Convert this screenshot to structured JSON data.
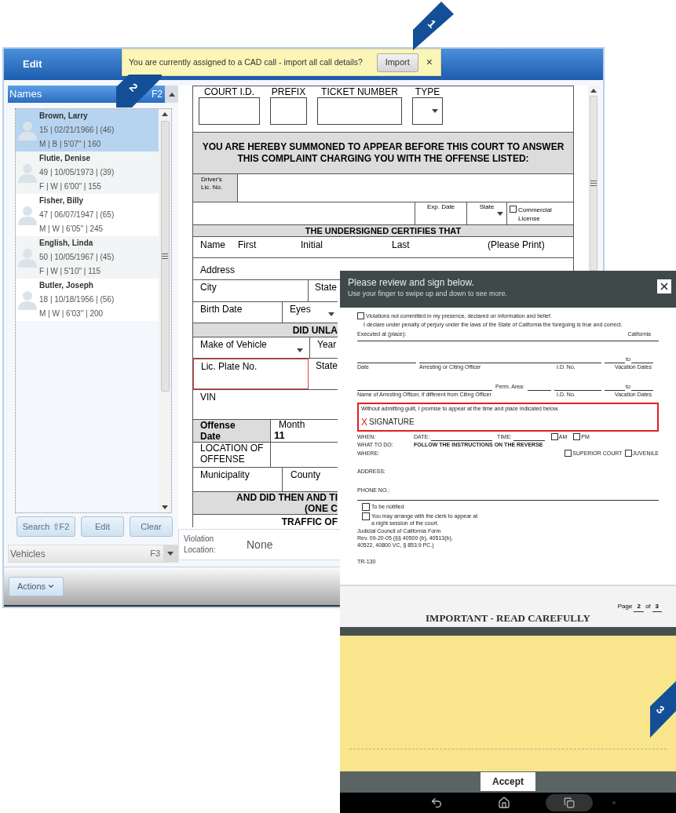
{
  "window": {
    "title": "Edit"
  },
  "notification": {
    "message": "You are currently assigned to a CAD call - import all call details?",
    "button": "Import",
    "close": "×"
  },
  "callouts": [
    {
      "number": "1"
    },
    {
      "number": "2"
    },
    {
      "number": "3"
    }
  ],
  "names_panel": {
    "title": "Names",
    "shortcut": "F2",
    "expanded": true,
    "items": [
      {
        "name": "Brown, Larry",
        "details": "15 | 02/21/1966 | (46)",
        "description": "M | B | 5'07\" | 160",
        "selected": true
      },
      {
        "name": "Flutie, Denise",
        "details": "49 | 10/05/1973 | (39)",
        "description": "F | W | 6'00\" | 155",
        "selected": false
      },
      {
        "name": "Fisher, Billy",
        "details": "47 | 06/07/1947 | (65)",
        "description": "M | W | 6'05\" | 245",
        "selected": false
      },
      {
        "name": "English, Linda",
        "details": "50 | 10/05/1967 | (45)",
        "description": "F | W | 5'10\" | 115",
        "selected": false
      },
      {
        "name": "Butler, Joseph",
        "details": "18 | 10/18/1956 | (56)",
        "description": "M | W | 6'03\" | 200",
        "selected": false
      }
    ],
    "buttons": [
      "Search ⇧F2",
      "Edit",
      "Clear"
    ]
  },
  "vehicles_panel": {
    "title": "Vehicles",
    "shortcut": "F3",
    "expanded": false
  },
  "actions_button": "Actions",
  "citation_form": {
    "header_fields": [
      {
        "label": "COURT I.D.",
        "kind": "text"
      },
      {
        "label": "PREFIX",
        "kind": "text"
      },
      {
        "label": "TICKET NUMBER",
        "kind": "text"
      },
      {
        "label": "TYPE",
        "kind": "dropdown"
      }
    ],
    "summons": [
      "YOU ARE HEREBY SUMMONED TO APPEAR BEFORE THIS COURT TO ANSWER",
      "THIS COMPLAINT CHARGING YOU WITH THE OFFENSE LISTED:"
    ],
    "drivers_license_label": "Driver's Lic. No.",
    "exp_date_label": "Exp. Date",
    "license_state_label": "State",
    "commercial_license": {
      "label": "Commercial License",
      "checked": false
    },
    "certifies_heading": "THE UNDERSIGNED CERTIFIES THAT",
    "name_labels": [
      "Name",
      "First",
      "Initial",
      "Last",
      "(Please Print)"
    ],
    "address_label": "Address",
    "city_label": "City",
    "city_state_label": "State",
    "birth_date_label": "Birth Date",
    "eyes_label": "Eyes",
    "vehicle_heading": "DID UNLA",
    "make_label": "Make of Vehicle",
    "year_label": "Year",
    "plate": {
      "label": "Lic. Plate No.",
      "highlighted": true
    },
    "plate_state_label": "State",
    "vin_label": "VIN",
    "offense_date_label": "Offense Date",
    "month_label": "Month",
    "month_value": "11",
    "location_label": "LOCATION OF OFFENSE",
    "municipality_label": "Municipality",
    "county_label": "County",
    "charge_heading": [
      "AND DID THEN AND TI",
      "(ONE C"
    ],
    "traffic_heading": "TRAFFIC OF"
  },
  "violation_location": {
    "label": "Violation Location:",
    "value": "None"
  },
  "signature_dialog": {
    "title": "Please review and sign below.",
    "hint": "Use your finger to swipe up and down to see more.",
    "document": {
      "belief": {
        "label": "Violations not committed in my presence, declared on information and belief.",
        "checked": false
      },
      "declaration": "I declare under penalty of perjury under the laws of the State of California the foregoing is true and correct.",
      "executed_label": "Executed at (place):",
      "executed_state": "California",
      "officer_line": [
        "Date",
        "Arresting or Citing Officer",
        "I.D. No.",
        "Vacation Dates"
      ],
      "officer_to": "to",
      "second_officer_line": [
        "Name of Arresting Officer, if different from Citing Officer",
        "I.D. No.",
        "Vacation Dates"
      ],
      "perm_area_label": "Perm. Area:",
      "second_to": "to",
      "promise": "Without admitting guilt, I promise to appear at the time and place indicated below.",
      "signature_mark": "X",
      "signature_label": "SIGNATURE",
      "when_label": "WHEN:",
      "date_label": "DATE:",
      "time_label": "TIME:",
      "meridiem": [
        {
          "label": "AM",
          "checked": false
        },
        {
          "label": "PM",
          "checked": false
        }
      ],
      "what_label": "WHAT TO DO:",
      "what_value": "FOLLOW THE INSTRUCTIONS ON THE REVERSE",
      "where_label": "WHERE:",
      "courts": [
        {
          "label": "SUPERIOR COURT",
          "checked": false
        },
        {
          "label": "JUVENILE",
          "checked": false
        }
      ],
      "address_label": "ADDRESS:",
      "phone_label": "PHONE NO.:",
      "options": [
        {
          "label": "To be notified",
          "checked": false
        },
        {
          "label": "You may arrange with the clerk to appear at a night session of the court.",
          "checked": false
        }
      ],
      "form_source": [
        "Judicial Council of California Form",
        "Rev. 09-20-05 (§§ 40500 (b), 40513(b),",
        "40522, 40800 VC, § 853.9 PC.)"
      ],
      "form_number": "TR-130",
      "page": {
        "label": "Page",
        "current": "2",
        "of": "of",
        "total": "3"
      },
      "next_heading": "IMPORTANT - READ CAREFULLY"
    },
    "accept_button": "Accept"
  }
}
